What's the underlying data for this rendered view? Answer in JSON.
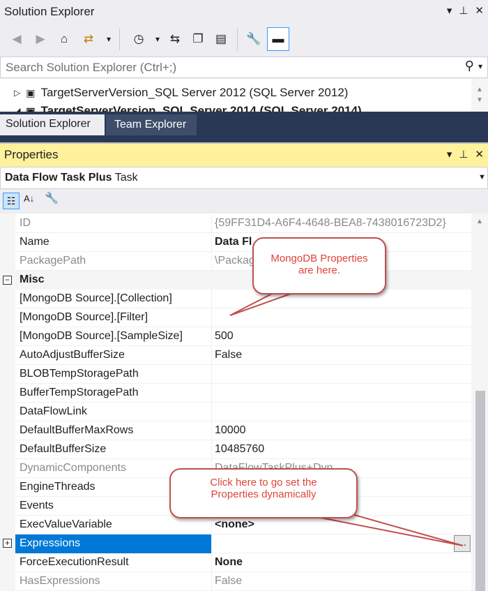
{
  "solution_explorer": {
    "title": "Solution Explorer",
    "window_buttons": [
      "▾",
      "⊥",
      "✕"
    ],
    "search_placeholder": "Search Solution Explorer (Ctrl+;)",
    "tree": [
      {
        "label": "TargetServerVersion_SQL Server 2012 (SQL Server 2012)"
      },
      {
        "label": "TargetServerVersion_SQL Server 2014 (SQL Server 2014)"
      }
    ],
    "tabs": [
      "Solution Explorer",
      "Team Explorer"
    ]
  },
  "properties": {
    "title": "Properties",
    "object_name": "Data Flow Task Plus",
    "object_type": "Task",
    "category": "Misc",
    "rows_top": [
      {
        "name": "ID",
        "value": "{59FF31D4-A6F4-4648-BEA8-7438016723D2}",
        "gray": true,
        "bold": false
      },
      {
        "name": "Name",
        "value": "Data Fl",
        "gray": false,
        "bold": true
      },
      {
        "name": "PackagePath",
        "value": "\\Packag",
        "gray": true,
        "bold": false
      }
    ],
    "rows_misc": [
      {
        "name": "[MongoDB Source].[Collection]",
        "value": "",
        "gray": false,
        "bold": false
      },
      {
        "name": "[MongoDB Source].[Filter]",
        "value": "",
        "gray": false,
        "bold": false
      },
      {
        "name": "[MongoDB Source].[SampleSize]",
        "value": "500",
        "gray": false,
        "bold": false
      },
      {
        "name": "AutoAdjustBufferSize",
        "value": "False",
        "gray": false,
        "bold": false
      },
      {
        "name": "BLOBTempStoragePath",
        "value": "",
        "gray": false,
        "bold": false
      },
      {
        "name": "BufferTempStoragePath",
        "value": "",
        "gray": false,
        "bold": false
      },
      {
        "name": "DataFlowLink",
        "value": "",
        "gray": false,
        "bold": false
      },
      {
        "name": "DefaultBufferMaxRows",
        "value": "10000",
        "gray": false,
        "bold": false
      },
      {
        "name": "DefaultBufferSize",
        "value": "10485760",
        "gray": false,
        "bold": false
      },
      {
        "name": "DynamicComponents",
        "value": "DataFlowTaskPlus+Dyn",
        "gray": true,
        "bold": false
      },
      {
        "name": "EngineThreads",
        "value": "",
        "gray": false,
        "bold": false
      },
      {
        "name": "Events",
        "value": "",
        "gray": false,
        "bold": false
      },
      {
        "name": "ExecValueVariable",
        "value": "<none>",
        "gray": false,
        "bold": true
      },
      {
        "name": "Expressions",
        "value": "",
        "gray": false,
        "bold": false,
        "selected": true
      },
      {
        "name": "ForceExecutionResult",
        "value": "None",
        "gray": false,
        "bold": true
      },
      {
        "name": "HasExpressions",
        "value": "False",
        "gray": true,
        "bold": false
      }
    ],
    "ellipsis_label": "..."
  },
  "callouts": {
    "mongo": "MongoDB Properties are here.",
    "expressions": "Click here to go set the Properties dynamically"
  },
  "colors": {
    "accent_blue": "#0078d7",
    "tab_bar": "#293955",
    "properties_title": "#fff29d",
    "callout_border": "#c0504d",
    "callout_text": "#e0443b"
  }
}
